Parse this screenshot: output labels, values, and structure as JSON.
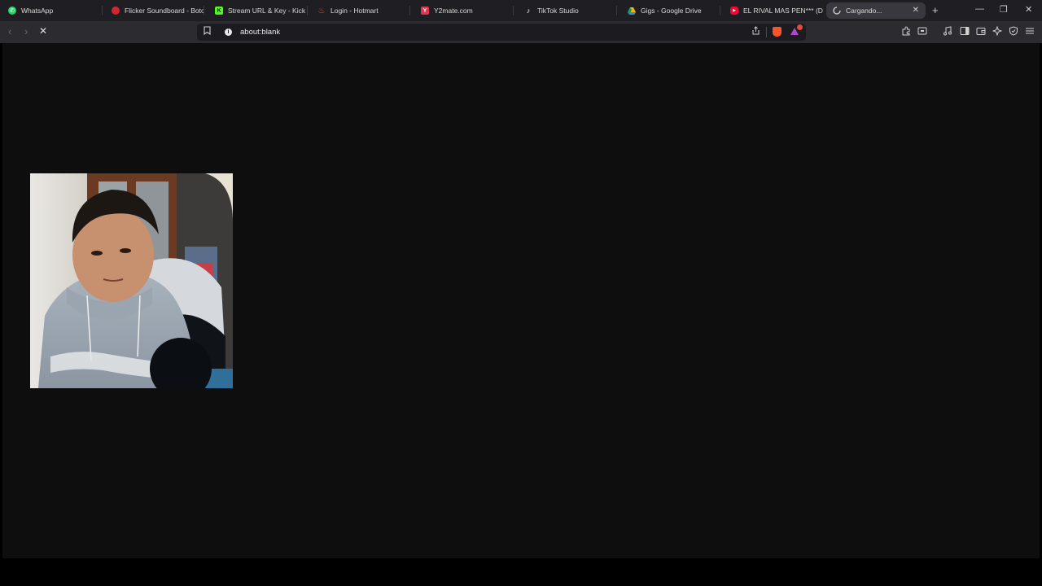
{
  "tabs": [
    {
      "title": "WhatsApp",
      "icon": "whatsapp-icon",
      "color": "#25d366"
    },
    {
      "title": "Flicker Soundboard - Boto",
      "icon": "flicker-icon",
      "color": "#d4262e"
    },
    {
      "title": "Stream URL & Key - Kick D",
      "icon": "kick-icon",
      "color": "#53fc18"
    },
    {
      "title": "Login - Hotmart",
      "icon": "hotmart-icon",
      "color": "#f04e23"
    },
    {
      "title": "Y2mate.com",
      "icon": "y2mate-icon",
      "color": "#e3344d"
    },
    {
      "title": "TikTok Studio",
      "icon": "tiktok-icon",
      "color": "#ffffff"
    },
    {
      "title": "Gigs - Google Drive",
      "icon": "google-drive-icon",
      "color": "#f4b400"
    },
    {
      "title": "EL RIVAL MAS PEN*** (DE",
      "icon": "youtube-icon",
      "color": "#ff0033"
    },
    {
      "title": "Cargando...",
      "icon": "loading-spinner-icon",
      "color": "#cfcfcf",
      "active": true
    }
  ],
  "address_bar": {
    "url": "about:blank"
  },
  "colors": {
    "tabbar_bg": "#1f1f23",
    "toolbar_bg": "#2b2b30",
    "page_bg": "#0e0e0e",
    "brave_orange": "#fb542b"
  },
  "toolbar_icons": [
    "extensions-icon",
    "screenshot-icon",
    "music-playlist-icon",
    "sidebar-icon",
    "wallet-icon",
    "leo-ai-icon",
    "vpn-shield-icon",
    "menu-icon"
  ],
  "page": {
    "content": "webcam-video-frame"
  }
}
